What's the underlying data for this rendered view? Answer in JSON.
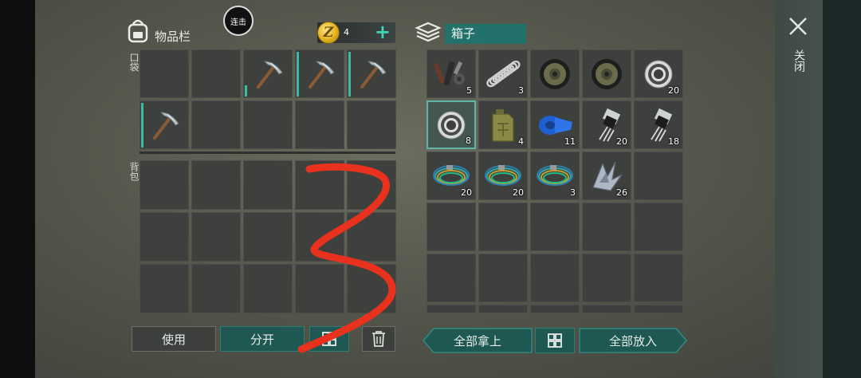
{
  "inventory": {
    "title": "物品栏",
    "pocket_label": "口袋",
    "backpack_label": "背包",
    "combo_label": "连击"
  },
  "currency": {
    "coin_symbol": "Z",
    "amount": "4",
    "add_label": "+"
  },
  "container": {
    "title": "箱子",
    "close_label": "关闭"
  },
  "pocket_slots": [
    {
      "item": "",
      "icon": "empty"
    },
    {
      "item": "",
      "icon": "empty"
    },
    {
      "item": "pickaxe",
      "icon": "pickaxe-icon",
      "durability": 0.25
    },
    {
      "item": "pickaxe",
      "icon": "pickaxe-icon",
      "durability": 1.0
    },
    {
      "item": "pickaxe",
      "icon": "pickaxe-icon",
      "durability": 1.0
    },
    {
      "item": "pickaxe",
      "icon": "pickaxe-icon",
      "durability": 1.0
    },
    {
      "item": "",
      "icon": "empty"
    },
    {
      "item": "",
      "icon": "empty"
    },
    {
      "item": "",
      "icon": "empty"
    },
    {
      "item": "",
      "icon": "empty"
    }
  ],
  "backpack_slots_count": 15,
  "box_slots": [
    {
      "icon": "tools-icon",
      "count": "5"
    },
    {
      "icon": "spring-icon",
      "count": "3"
    },
    {
      "icon": "disc-icon",
      "count": ""
    },
    {
      "icon": "disc-icon",
      "count": ""
    },
    {
      "icon": "bearing-icon",
      "count": "20"
    },
    {
      "icon": "bearing-icon",
      "count": "8",
      "selected": true
    },
    {
      "icon": "jerrycan-icon",
      "count": "4"
    },
    {
      "icon": "tape-icon",
      "count": "11"
    },
    {
      "icon": "transistor-icon",
      "count": "20"
    },
    {
      "icon": "transistor-icon",
      "count": "18"
    },
    {
      "icon": "wire-icon",
      "count": "20"
    },
    {
      "icon": "wire-icon",
      "count": "20"
    },
    {
      "icon": "wire-icon",
      "count": "3"
    },
    {
      "icon": "scrap-metal-icon",
      "count": "26"
    },
    {
      "icon": "empty",
      "count": ""
    },
    {
      "icon": "empty",
      "count": ""
    },
    {
      "icon": "empty",
      "count": ""
    },
    {
      "icon": "empty",
      "count": ""
    },
    {
      "icon": "empty",
      "count": ""
    },
    {
      "icon": "empty",
      "count": ""
    },
    {
      "icon": "empty",
      "count": ""
    },
    {
      "icon": "empty",
      "count": ""
    },
    {
      "icon": "empty",
      "count": ""
    },
    {
      "icon": "empty",
      "count": ""
    },
    {
      "icon": "empty",
      "count": ""
    },
    {
      "icon": "empty",
      "count": ""
    },
    {
      "icon": "empty",
      "count": ""
    },
    {
      "icon": "empty",
      "count": ""
    },
    {
      "icon": "empty",
      "count": ""
    },
    {
      "icon": "empty",
      "count": ""
    }
  ],
  "buttons": {
    "use": "使用",
    "split": "分开",
    "take_all": "全部拿上",
    "put_all": "全部放入"
  },
  "colors": {
    "accent": "#23716b",
    "plus": "#3fd4b8",
    "annotation": "#e8321e"
  }
}
